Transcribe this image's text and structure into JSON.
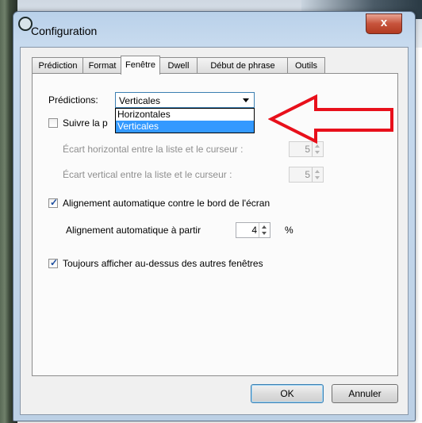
{
  "window": {
    "title": "Configuration",
    "close_glyph": "x"
  },
  "tabs": [
    {
      "label": "Prédiction",
      "active": false
    },
    {
      "label": "Format",
      "active": false
    },
    {
      "label": "Fenêtre",
      "active": true
    },
    {
      "label": "Dwell",
      "active": false
    },
    {
      "label": "Début de phrase",
      "active": false
    },
    {
      "label": "Outils",
      "active": false
    }
  ],
  "predictions": {
    "label": "Prédictions:",
    "selected": "Verticales",
    "options": [
      "Horizontales",
      "Verticales"
    ]
  },
  "follow_cursor": {
    "label": "Suivre la p",
    "checked": false
  },
  "horizontal_gap": {
    "label": "Écart horizontal entre la liste et le curseur :",
    "value": "5",
    "enabled": false
  },
  "vertical_gap": {
    "label": "Écart vertical entre la liste et le curseur :",
    "value": "5",
    "enabled": false
  },
  "auto_align": {
    "label": "Alignement automatique contre le bord de l'écran",
    "checked": true
  },
  "auto_align_from": {
    "label": "Alignement automatique à partir",
    "value": "4",
    "unit": "%"
  },
  "always_on_top": {
    "label": "Toujours afficher au-dessus des autres fenêtres",
    "checked": true
  },
  "buttons": {
    "ok": "OK",
    "cancel": "Annuler"
  },
  "colors": {
    "selection": "#3399ff",
    "annotation_arrow": "#e8101b"
  },
  "icons": {
    "check": "✓"
  }
}
